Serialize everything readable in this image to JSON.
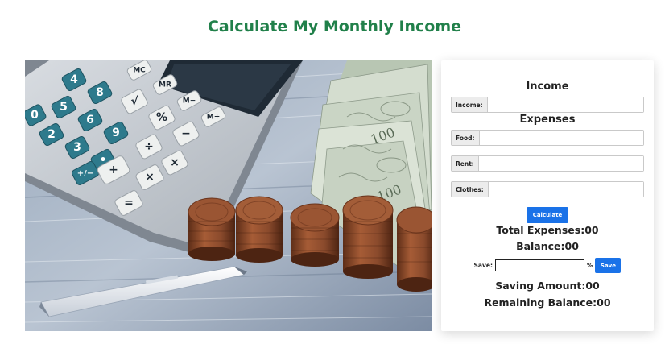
{
  "page": {
    "title": "Calculate My Monthly Income"
  },
  "hero": {
    "icon": "calculator-money-coins-photo",
    "keys": [
      "4",
      "8",
      "9",
      "M−",
      "M+",
      "5",
      "6",
      "√",
      "%",
      "2",
      "3",
      "−",
      "•",
      "÷",
      "+",
      "×",
      "="
    ],
    "key_special": [
      "MC",
      "MR",
      "+/−",
      "0"
    ]
  },
  "income": {
    "heading": "Income",
    "field_label": "Income:",
    "field_value": ""
  },
  "expenses": {
    "heading": "Expenses",
    "food_label": "Food:",
    "food_value": "",
    "rent_label": "Rent:",
    "rent_value": "",
    "clothes_label": "Clothes:",
    "clothes_value": ""
  },
  "actions": {
    "calculate_label": "Calculate",
    "save_label": "Save"
  },
  "results": {
    "total_expenses": "Total Expenses:00",
    "balance": "Balance:00",
    "save_label": "Save:",
    "save_value": "",
    "percent_sign": "%",
    "saving_amount": "Saving Amount:00",
    "remaining_balance": "Remaining Balance:00"
  },
  "colors": {
    "title_green": "#21804a",
    "button_blue": "#1a72e8",
    "calculator_body": "#c4c9cf",
    "calculator_key_teal": "#2e7a8c",
    "coin_copper": "#8a4a2c",
    "banknote_green": "#c9d6c4",
    "table_blue_grey": "#8fa0b5"
  }
}
